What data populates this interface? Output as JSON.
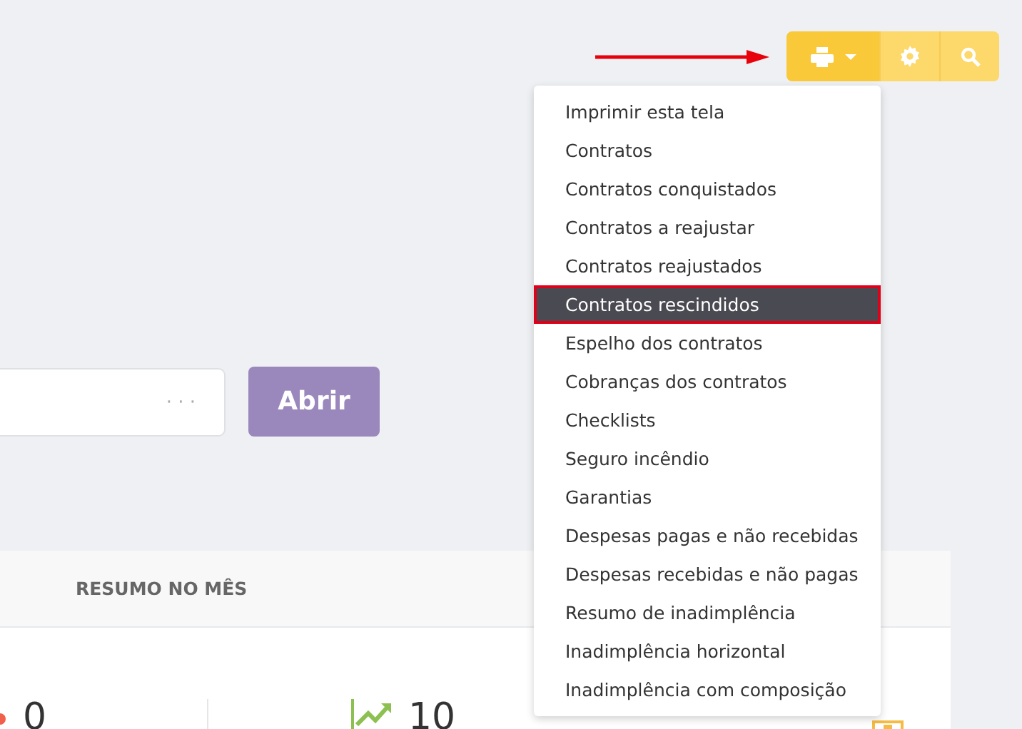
{
  "toolbar": {
    "buttons": [
      {
        "kind": "print",
        "active": true
      },
      {
        "kind": "settings",
        "active": false
      },
      {
        "kind": "search",
        "active": false
      }
    ]
  },
  "open_form": {
    "field": {
      "placeholder": "· · ·"
    },
    "button": "Abrir"
  },
  "card": {
    "header": "RESUMO NO MÊS",
    "stats": [
      {
        "kind": "down",
        "value": "0"
      },
      {
        "kind": "up",
        "value": "10"
      },
      {
        "kind": "warn"
      }
    ]
  },
  "print_menu": {
    "items": [
      {
        "label": "Imprimir esta tela",
        "selected": false
      },
      {
        "label": "Contratos",
        "selected": false
      },
      {
        "label": "Contratos conquistados",
        "selected": false
      },
      {
        "label": "Contratos a reajustar",
        "selected": false
      },
      {
        "label": "Contratos reajustados",
        "selected": false
      },
      {
        "label": "Contratos rescindidos",
        "selected": true
      },
      {
        "label": "Espelho dos contratos",
        "selected": false
      },
      {
        "label": "Cobranças dos contratos",
        "selected": false
      },
      {
        "label": "Checklists",
        "selected": false
      },
      {
        "label": "Seguro incêndio",
        "selected": false
      },
      {
        "label": "Garantias",
        "selected": false
      },
      {
        "label": "Despesas pagas e não recebidas",
        "selected": false
      },
      {
        "label": "Despesas recebidas e não pagas",
        "selected": false
      },
      {
        "label": "Resumo de inadimplência",
        "selected": false
      },
      {
        "label": "Inadimplência horizontal",
        "selected": false
      },
      {
        "label": "Inadimplência com composição",
        "selected": false
      }
    ]
  }
}
